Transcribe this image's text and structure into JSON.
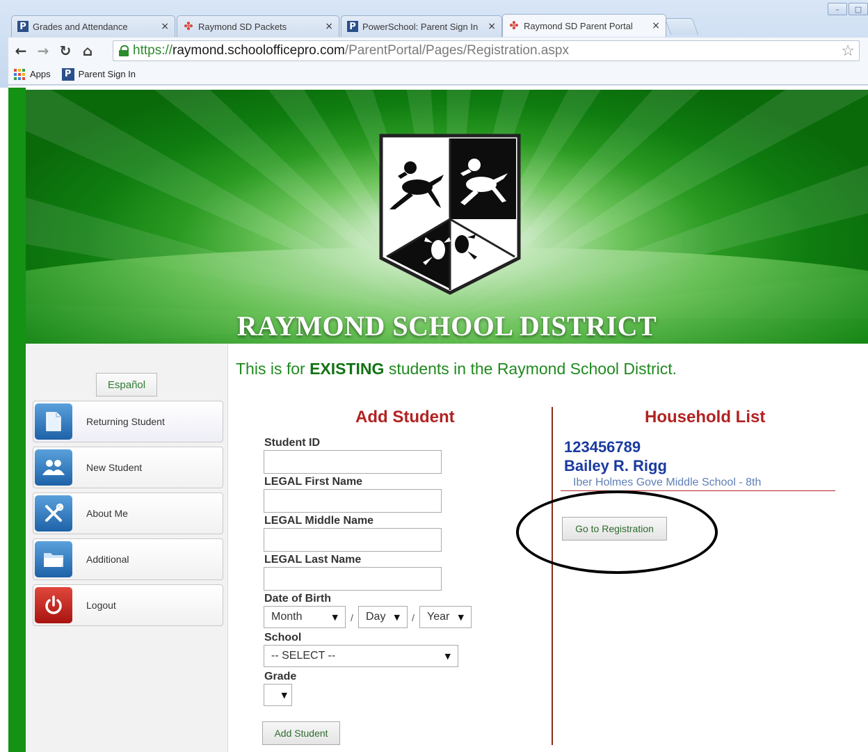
{
  "browser": {
    "tabs": [
      {
        "title": "Grades and Attendance",
        "favicon": "p-icon"
      },
      {
        "title": "Raymond SD Packets",
        "favicon": "pinwheel-icon"
      },
      {
        "title": "PowerSchool: Parent Sign In",
        "favicon": "p-icon"
      },
      {
        "title": "Raymond SD Parent Portal",
        "favicon": "pinwheel-icon"
      }
    ],
    "close_glyph": "×",
    "url_scheme": "https://",
    "url_host": "raymond.schoolofficepro.com",
    "url_path": "/ParentPortal/Pages/Registration.aspx",
    "bookmarks": [
      {
        "label": "Apps",
        "icon": "apps-grid-icon"
      },
      {
        "label": "Parent Sign In",
        "icon": "p-icon"
      }
    ]
  },
  "banner": {
    "district_name": "RAYMOND SCHOOL DISTRICT"
  },
  "sidebar": {
    "language_button": "Español",
    "items": [
      {
        "label": "Returning Student",
        "icon": "document-icon"
      },
      {
        "label": "New Student",
        "icon": "people-icon"
      },
      {
        "label": "About Me",
        "icon": "tools-icon"
      },
      {
        "label": "Additional",
        "icon": "folder-icon"
      },
      {
        "label": "Logout",
        "icon": "power-icon"
      }
    ]
  },
  "main": {
    "notice_pre": "This is for ",
    "notice_bold": "EXISTING",
    "notice_post": " students in the Raymond School District.",
    "add_student": {
      "heading": "Add Student",
      "fields": {
        "student_id": "Student ID",
        "first_name": "LEGAL First Name",
        "middle_name": "LEGAL Middle Name",
        "last_name": "LEGAL Last Name",
        "dob": "Date of Birth",
        "school": "School",
        "grade": "Grade"
      },
      "dob_selects": {
        "month": "Month",
        "day": "Day",
        "year": "Year",
        "separator": "/"
      },
      "school_select": "-- SELECT --",
      "grade_select": "",
      "submit": "Add Student"
    },
    "household": {
      "heading": "Household List",
      "student_id": "123456789",
      "student_name": "Bailey R. Rigg",
      "school_grade": "Iber Holmes Gove Middle School - 8th",
      "go_button": "Go to Registration"
    }
  },
  "colors": {
    "brand_green": "#149214",
    "heading_red": "#b22222",
    "household_blue": "#1a3aa0"
  }
}
